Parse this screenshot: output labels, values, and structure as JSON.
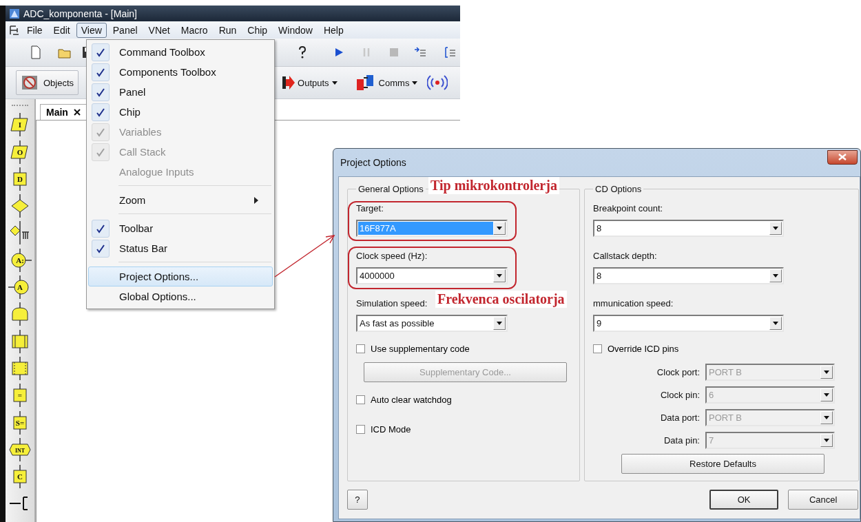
{
  "window": {
    "title": "ADC_komponenta - [Main]"
  },
  "menu_bar": [
    {
      "label": "File",
      "selected": false
    },
    {
      "label": "Edit",
      "selected": false
    },
    {
      "label": "View",
      "selected": true
    },
    {
      "label": "Panel",
      "selected": false
    },
    {
      "label": "VNet",
      "selected": false
    },
    {
      "label": "Macro",
      "selected": false
    },
    {
      "label": "Run",
      "selected": false
    },
    {
      "label": "Chip",
      "selected": false
    },
    {
      "label": "Window",
      "selected": false
    },
    {
      "label": "Help",
      "selected": false
    }
  ],
  "toolbar_buttons": [
    {
      "label": "Objects",
      "kind": "objects"
    },
    {
      "label": "Outputs",
      "kind": "outputs"
    },
    {
      "label": "Comms",
      "kind": "comms"
    }
  ],
  "tabs": [
    {
      "label": "Main",
      "selected": true
    }
  ],
  "palette": [
    {
      "kind": "parallelogram",
      "label": "I"
    },
    {
      "kind": "parallelogram",
      "label": "O"
    },
    {
      "kind": "box",
      "label": "D"
    },
    {
      "kind": "diamond"
    },
    {
      "kind": "diamond-loop"
    },
    {
      "kind": "circle-right",
      "label": "A:"
    },
    {
      "kind": "circle-left",
      "label": "A"
    },
    {
      "kind": "dome"
    },
    {
      "kind": "rect"
    },
    {
      "kind": "rect-dotted"
    },
    {
      "kind": "box",
      "label": "="
    },
    {
      "kind": "box",
      "label": "S="
    },
    {
      "kind": "hex",
      "label": "INT"
    },
    {
      "kind": "box",
      "label": "C"
    },
    {
      "kind": "bracket"
    }
  ],
  "view_menu": [
    {
      "kind": "item",
      "label": "Command Toolbox",
      "checked": true,
      "disabled": false,
      "selected": false
    },
    {
      "kind": "item",
      "label": "Components Toolbox",
      "checked": true,
      "disabled": false,
      "selected": false
    },
    {
      "kind": "item",
      "label": "Panel",
      "checked": true,
      "disabled": false,
      "selected": false
    },
    {
      "kind": "item",
      "label": "Chip",
      "checked": true,
      "disabled": false,
      "selected": false
    },
    {
      "kind": "item",
      "label": "Variables",
      "checked": true,
      "disabled": true,
      "selected": false
    },
    {
      "kind": "item",
      "label": "Call Stack",
      "checked": true,
      "disabled": true,
      "selected": false
    },
    {
      "kind": "item",
      "label": "Analogue Inputs",
      "checked": false,
      "disabled": true,
      "selected": false
    },
    {
      "kind": "separator"
    },
    {
      "kind": "submenu",
      "label": "Zoom",
      "checked": false,
      "disabled": false,
      "selected": false
    },
    {
      "kind": "separator"
    },
    {
      "kind": "item",
      "label": "Toolbar",
      "checked": true,
      "disabled": false,
      "selected": false
    },
    {
      "kind": "item",
      "label": "Status Bar",
      "checked": true,
      "disabled": false,
      "selected": false
    },
    {
      "kind": "separator"
    },
    {
      "kind": "item",
      "label": "Project Options...",
      "checked": false,
      "disabled": false,
      "selected": true
    },
    {
      "kind": "item",
      "label": "Global Options...",
      "checked": false,
      "disabled": false,
      "selected": false
    }
  ],
  "dialog": {
    "title": "Project Options",
    "groups": [
      {
        "legend": "General Options",
        "items": [
          {
            "kind": "combo",
            "label": "Target:",
            "value": "16F877A",
            "selected": true,
            "disabled": false
          },
          {
            "kind": "combo",
            "label": "Clock speed (Hz):",
            "value": "4000000",
            "selected": false,
            "disabled": false
          },
          {
            "kind": "combo",
            "label": "Simulation speed:",
            "value": "As fast as possible",
            "selected": false,
            "disabled": false
          },
          {
            "kind": "checkbox",
            "label": "Use supplementary code",
            "checked": false
          },
          {
            "kind": "button",
            "label": "Supplementary Code...",
            "disabled": true
          },
          {
            "kind": "checkbox",
            "label": "Auto clear watchdog",
            "checked": false
          },
          {
            "kind": "checkbox",
            "label": "ICD Mode",
            "checked": false
          }
        ]
      },
      {
        "legend": "CD Options",
        "items": [
          {
            "kind": "combo",
            "label": "Breakpoint count:",
            "value": "8",
            "selected": false,
            "disabled": false
          },
          {
            "kind": "combo",
            "label": "Callstack depth:",
            "value": "8",
            "selected": false,
            "disabled": false
          },
          {
            "kind": "combo",
            "label": "mmunication speed:",
            "value": "9",
            "selected": false,
            "disabled": false
          },
          {
            "kind": "checkbox",
            "label": "Override ICD pins",
            "checked": false
          },
          {
            "kind": "pin",
            "label": "Clock port:",
            "value": "PORT B",
            "disabled": true
          },
          {
            "kind": "pin",
            "label": "Clock pin:",
            "value": "6",
            "disabled": true
          },
          {
            "kind": "pin",
            "label": "Data port:",
            "value": "PORT B",
            "disabled": true
          },
          {
            "kind": "pin",
            "label": "Data pin:",
            "value": "7",
            "disabled": true
          },
          {
            "kind": "button",
            "label": "Restore Defaults",
            "disabled": false
          }
        ]
      }
    ],
    "buttons": [
      {
        "label": "?",
        "kind": "help"
      },
      {
        "label": "OK",
        "kind": "default"
      },
      {
        "label": "Cancel",
        "kind": "normal"
      }
    ]
  },
  "annotations": [
    {
      "text": "Tip mikrokontrolerja"
    },
    {
      "text": "Frekvenca oscilatorja"
    }
  ]
}
